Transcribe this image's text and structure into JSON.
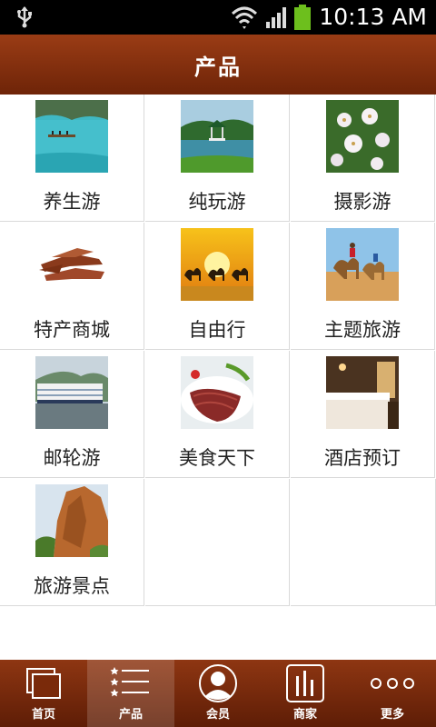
{
  "status_bar": {
    "time": "10:13 AM",
    "icons": [
      "usb-icon",
      "wifi-icon",
      "signal-icon",
      "battery-icon"
    ],
    "battery_color": "#6dbf1d"
  },
  "header": {
    "title": "产品",
    "background": "#7f2c0c"
  },
  "products": [
    {
      "label": "养生游",
      "image": "lake-boat-photo"
    },
    {
      "label": "纯玩游",
      "image": "pavilion-lake-photo"
    },
    {
      "label": "摄影游",
      "image": "white-flowers-photo"
    },
    {
      "label": "特产商城",
      "image": "dried-roots-photo"
    },
    {
      "label": "自由行",
      "image": "desert-camels-sunset-photo"
    },
    {
      "label": "主题旅游",
      "image": "camel-riders-photo"
    },
    {
      "label": "邮轮游",
      "image": "cruise-ship-photo"
    },
    {
      "label": "美食天下",
      "image": "sliced-meat-dish-photo"
    },
    {
      "label": "酒店预订",
      "image": "hotel-room-photo"
    },
    {
      "label": "旅游景点",
      "image": "red-cliff-photo"
    }
  ],
  "bottom_nav": {
    "items": [
      {
        "label": "首页",
        "icon": "home-pages-icon"
      },
      {
        "label": "产品",
        "icon": "star-list-icon",
        "active": true
      },
      {
        "label": "会员",
        "icon": "member-avatar-icon"
      },
      {
        "label": "商家",
        "icon": "merchant-chart-icon"
      },
      {
        "label": "更多",
        "icon": "more-dots-icon"
      }
    ]
  }
}
